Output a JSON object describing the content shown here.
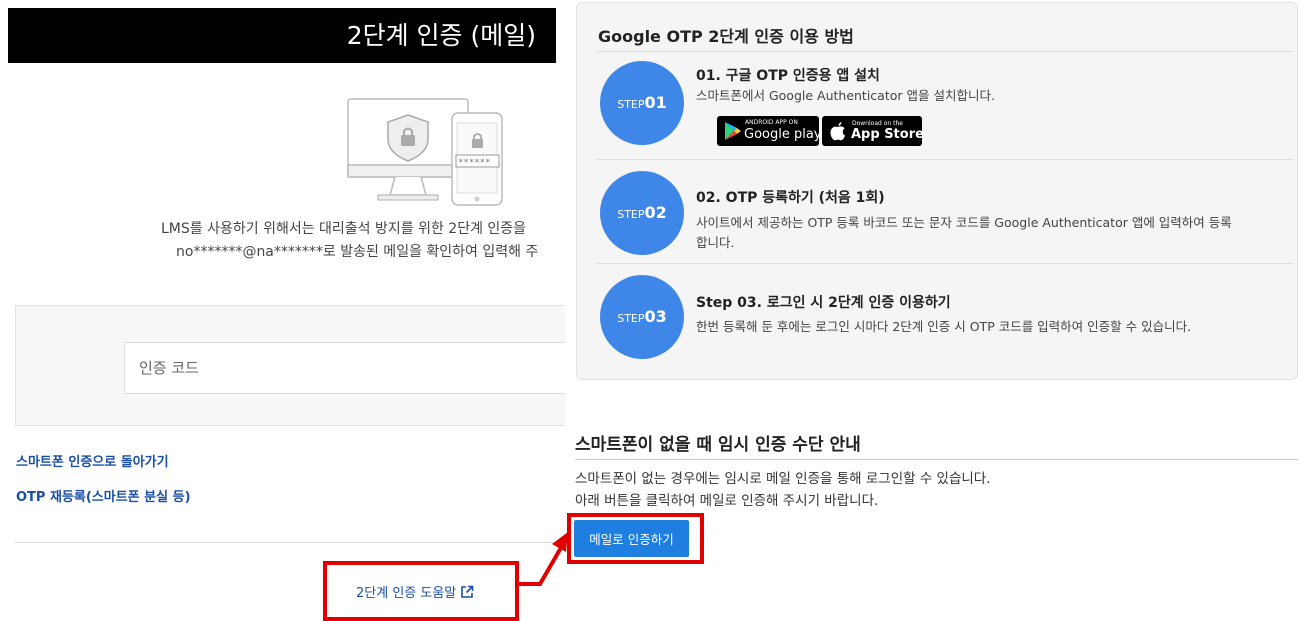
{
  "left": {
    "header_title": "2단계 인증 (메일)",
    "message_line1": "LMS를 사용하기 위해서는 대리출석 방지를 위한 2단계 인증을",
    "message_line2": "no*******@na*******로 발송된 메일을 확인하여 입력해 주",
    "code_input_placeholder": "인증 코드",
    "link_back_to_smartphone": "스마트폰 인증으로 돌아가기",
    "link_otp_reregister": "OTP 재등록(스마트폰 분실 등)",
    "help_link": "2단계 인증 도움말",
    "illustration_password_mask": "******"
  },
  "otp_guide": {
    "title": "Google OTP 2단계 인증 이용 방법",
    "steps": [
      {
        "badge_prefix": "STEP",
        "badge_number": "01",
        "title": "01. 구글 OTP 인증용 앱 설치",
        "description": "스마트폰에서 Google Authenticator 앱을 설치합니다."
      },
      {
        "badge_prefix": "STEP",
        "badge_number": "02",
        "title": "02. OTP 등록하기 (처음 1회)",
        "description_line1": "사이트에서 제공하는 OTP 등록 바코드 또는 문자 코드를 Google Authenticator 앱에 입력하여 등록",
        "description_line2": "합니다."
      },
      {
        "badge_prefix": "STEP",
        "badge_number": "03",
        "title": "Step 03. 로그인 시 2단계 인증 이용하기",
        "description": "한번 등록해 둔 후에는 로그인 시마다 2단계 인증 시 OTP 코드를 입력하여 인증할 수 있습니다."
      }
    ],
    "store_badges": {
      "google_play_small": "ANDROID APP ON",
      "google_play_big": "Google play",
      "app_store_small": "Download on the",
      "app_store_big": "App Store"
    }
  },
  "temporary_auth": {
    "title": "스마트폰이 없을 때 임시 인증 수단 안내",
    "description_line1": "스마트폰이 없는 경우에는 임시로 메일 인증을 통해 로그인할 수 있습니다.",
    "description_line2": "아래 버튼을 클릭하여 메일로 인증해 주시기 바랍니다.",
    "button_label": "메일로 인증하기"
  },
  "colors": {
    "step_badge": "#3e87e8",
    "primary_button": "#1e7fe0",
    "highlight_box": "#e00000",
    "link": "#1a4fa3",
    "header_bg": "#000000"
  }
}
